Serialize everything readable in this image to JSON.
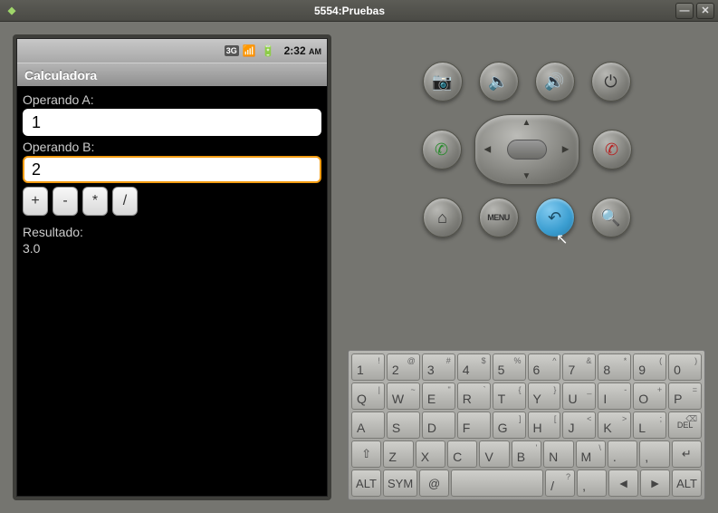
{
  "window": {
    "title": "5554:Pruebas"
  },
  "statusbar": {
    "time": "2:32",
    "ampm": "AM",
    "net": "3G"
  },
  "app": {
    "title": "Calculadora",
    "labelA": "Operando A:",
    "valueA": "1",
    "labelB": "Operando B:",
    "valueB": "2",
    "ops": {
      "add": "+",
      "sub": "-",
      "mul": "*",
      "div": "/"
    },
    "result_label": "Resultado:",
    "result_value": "3.0"
  },
  "hw": {
    "menu": "MENU"
  },
  "keyboard": {
    "row1": [
      {
        "m": "1",
        "s": "!"
      },
      {
        "m": "2",
        "s": "@"
      },
      {
        "m": "3",
        "s": "#"
      },
      {
        "m": "4",
        "s": "$"
      },
      {
        "m": "5",
        "s": "%"
      },
      {
        "m": "6",
        "s": "^"
      },
      {
        "m": "7",
        "s": "&"
      },
      {
        "m": "8",
        "s": "*"
      },
      {
        "m": "9",
        "s": "("
      },
      {
        "m": "0",
        "s": ")"
      }
    ],
    "row2": [
      {
        "m": "Q",
        "s": "|"
      },
      {
        "m": "W",
        "s": "~"
      },
      {
        "m": "E",
        "s": "\""
      },
      {
        "m": "R",
        "s": "`"
      },
      {
        "m": "T",
        "s": "{"
      },
      {
        "m": "Y",
        "s": "}"
      },
      {
        "m": "U",
        "s": "_"
      },
      {
        "m": "I",
        "s": "-"
      },
      {
        "m": "O",
        "s": "+"
      },
      {
        "m": "P",
        "s": "="
      }
    ],
    "row3": [
      {
        "m": "A"
      },
      {
        "m": "S"
      },
      {
        "m": "D"
      },
      {
        "m": "F"
      },
      {
        "m": "G",
        "s": "]"
      },
      {
        "m": "H",
        "s": "["
      },
      {
        "m": "J",
        "s": "<"
      },
      {
        "m": "K",
        "s": ">"
      },
      {
        "m": "L",
        "s": ";"
      }
    ],
    "row3_del": "DEL",
    "row4": [
      {
        "m": "Z"
      },
      {
        "m": "X"
      },
      {
        "m": "C"
      },
      {
        "m": "V"
      },
      {
        "m": "B",
        "s": "'"
      },
      {
        "m": "N"
      },
      {
        "m": "M",
        "s": "\\"
      },
      {
        "m": ".",
        "s": ""
      },
      {
        "m": ",",
        "s": ""
      }
    ],
    "shift": "⇧",
    "enter": "↵",
    "alt": "ALT",
    "sym": "SYM",
    "at": "@",
    "slash": "/",
    "comma": ",",
    "qmark": "?",
    "left": "◄",
    "right": "►"
  }
}
